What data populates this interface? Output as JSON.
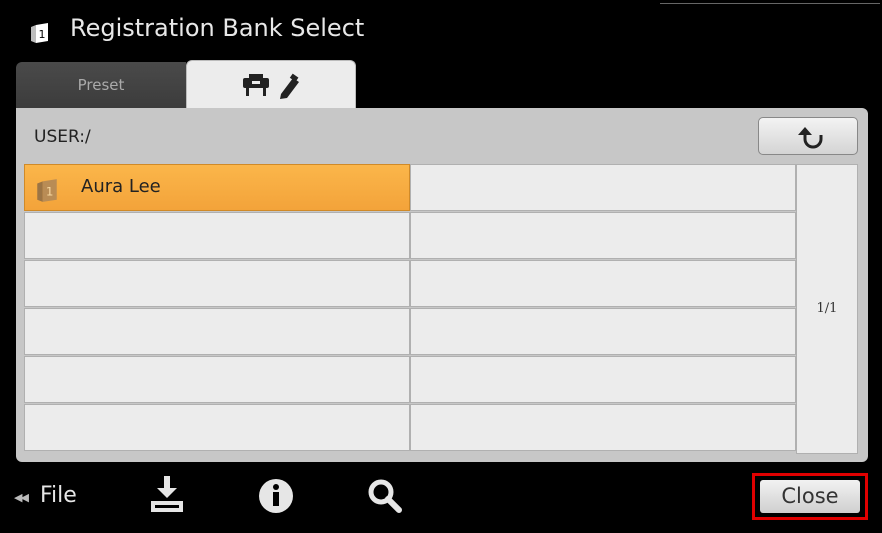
{
  "window": {
    "title": "Registration Bank Select",
    "title_icon": "registration-bank-icon"
  },
  "tabs": [
    {
      "label": "Preset",
      "selected": false
    },
    {
      "label": "",
      "icon": "piano-user-icon",
      "selected": true
    }
  ],
  "path": {
    "text": "USER:/"
  },
  "toolbar": {
    "up_icon": "up-folder-icon"
  },
  "files": [
    {
      "label": "Aura Lee",
      "icon": "registration-bank-icon",
      "selected": true
    },
    {
      "label": ""
    },
    {
      "label": ""
    },
    {
      "label": ""
    },
    {
      "label": ""
    },
    {
      "label": ""
    },
    {
      "label": ""
    },
    {
      "label": ""
    },
    {
      "label": ""
    },
    {
      "label": ""
    },
    {
      "label": ""
    },
    {
      "label": ""
    }
  ],
  "pager": {
    "text": "1/1"
  },
  "bottom": {
    "file_label": "File",
    "save_icon": "save-icon",
    "info_icon": "info-icon",
    "search_icon": "search-icon",
    "close_label": "Close"
  },
  "colors": {
    "accent": "#f7ab3f",
    "highlight_border": "#e00000",
    "background": "#000000"
  }
}
